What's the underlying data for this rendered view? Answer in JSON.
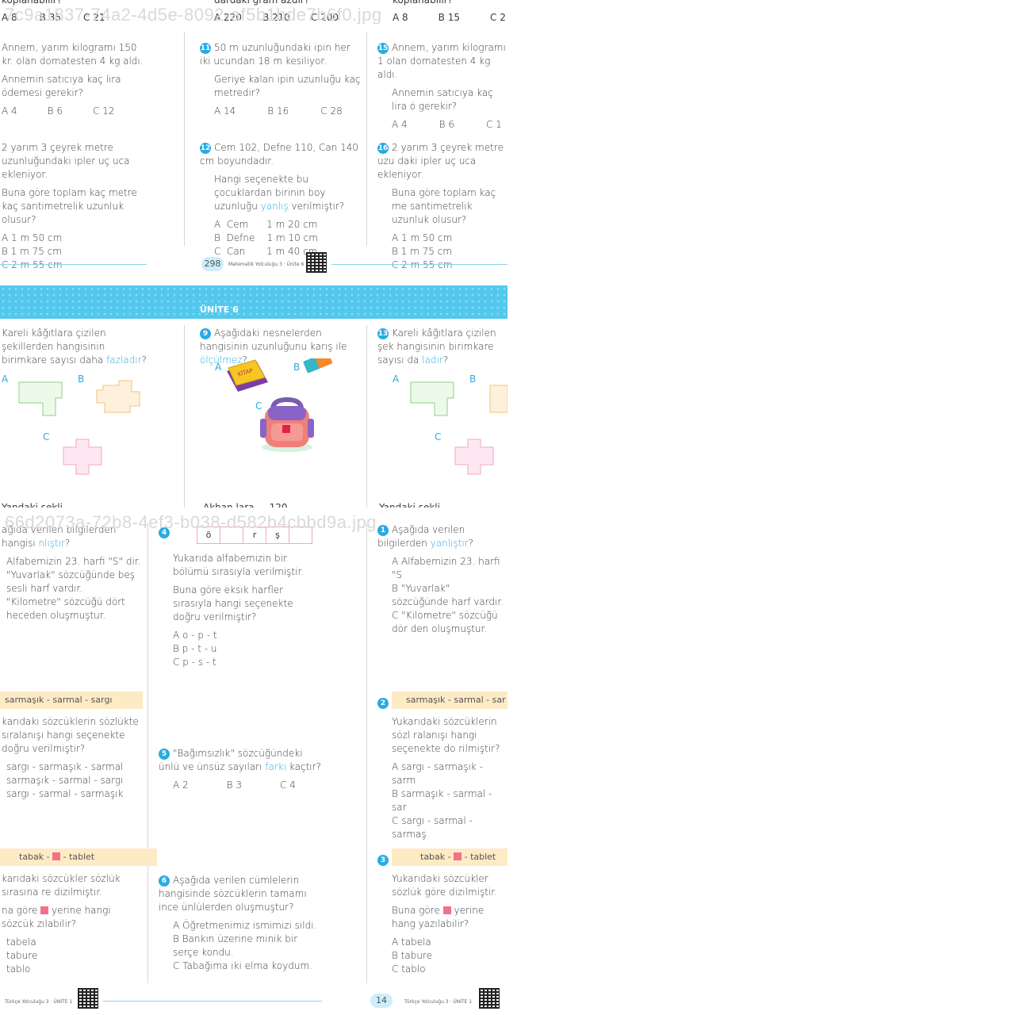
{
  "page_a": {
    "filename": "7c9a1837-74a2-4d5e-8092-af5b1bde7b6f0.jpg",
    "top_answers": {
      "left": [
        "A 8",
        "B 35",
        "C 21"
      ],
      "mid": [
        "A 220",
        "B 210",
        "C 200"
      ],
      "right": [
        "A 8",
        "B 15",
        "C 2"
      ]
    },
    "top_cut": {
      "left": "koplanabilir?",
      "mid": "dardaki gram azdır?",
      "right": "koplanabilir?"
    },
    "q_left_1": {
      "text": "Annem, yarım kilogramı 150 kr. olan domatesten 4 kg aldı.",
      "ask": "Annemin satıcıya kaç lira ödemesi gerekir?",
      "opts": [
        "A 4",
        "B 6",
        "C 12"
      ]
    },
    "q11": {
      "num": "11",
      "text": "50 m uzunluğundaki ipin her iki ucundan 18 m kesiliyor.",
      "ask": "Geriye kalan ipin uzunluğu kaç metredir?",
      "opts": [
        "A 14",
        "B 16",
        "C 28"
      ]
    },
    "q15": {
      "num": "15",
      "text": "Annem, yarım kilogramı 1 olan domatesten 4 kg aldı.",
      "ask": "Annemin satıcıya kaç lira ö gerekir?",
      "opts": [
        "A 4",
        "B 6",
        "C 1"
      ]
    },
    "q_left_2": {
      "text": "2 yarım 3 çeyrek metre uzunluğundaki ipler uç uca ekleniyor.",
      "ask": "Buna göre toplam kaç metre kaç santimetrelik uzunluk olusur?",
      "opts": [
        "A  1 m 50 cm",
        "B  1 m 75 cm",
        "C  2 m 55 cm"
      ]
    },
    "q12": {
      "num": "12",
      "text": "Cem 102, Defne 110, Can 140 cm boyundadır.",
      "ask_pre": "Hangi seçenekte bu çocuklardan birinin boy uzunluğu ",
      "ask_hl": "yanlış",
      "ask_post": " verilmiştir?",
      "opts": [
        "A  Cem      1 m 20 cm",
        "B  Defne    1 m 10 cm",
        "C  Can       1 m 40 cm"
      ]
    },
    "q16": {
      "num": "16",
      "text": "2 yarım 3 çeyrek metre uzu daki ipler uç uca ekleniyor.",
      "ask": "Buna göre toplam kaç me santimetrelik uzunluk olusur?",
      "opts": [
        "A  1 m 50 cm",
        "B  1 m 75 cm",
        "C  2 m 55 cm"
      ]
    },
    "page_number": "298",
    "footer": "Matematik Yolculuğu 3 · Ünite 6",
    "banner": "ÜNİTE 6",
    "q_left_3": {
      "pre": "Kareli kâğıtlara çizilen şekillerden hangisinin birimkare sayısı daha ",
      "hl": "fazladır",
      "post": "?",
      "labels": [
        "A",
        "B",
        "C"
      ]
    },
    "q9": {
      "num": "9",
      "pre": "Aşağıdaki nesnelerden hangisinin uzunluğunu karış ile ",
      "hl": "ölçülmez",
      "post": "?",
      "labels": [
        "A",
        "B",
        "C"
      ],
      "book_text": "KİTAP"
    },
    "q13": {
      "num": "13",
      "pre": "Kareli kâğıtlara çizilen şek hangisinin birimkare sayısı da ",
      "hl": "ladır",
      "post": "?",
      "labels": [
        "A",
        "B",
        "C"
      ]
    },
    "bottom_cut": {
      "left": "Yandaki şekli",
      "mid": "Akhan lara ... 120",
      "right": "Yandaki şekli"
    }
  },
  "page_b": {
    "filename": "66d2073a-72b8-4ef3-b038-d582b4cbbd9a.jpg",
    "q1_left": {
      "pre": "ağıda verilen bilgilerden hangisi ",
      "hl": "nlıştır",
      "post": "?",
      "opts": [
        "Alfabemizin 23. harfi \"S\" dir.",
        "\"Yuvarlak\" sözcüğünde beş sesli harf vardır.",
        "\"Kilometre\" sözcüğü dört heceden oluşmuştur."
      ]
    },
    "q4": {
      "num": "4",
      "letters": [
        "ö",
        "r",
        "ş"
      ],
      "text": "Yukarıda alfabemizin bir bölümü sırasıyla verilmiştir.",
      "ask": "Buna göre eksik harfler sırasıyla hangi seçenekte doğru verilmiştir?",
      "opts": [
        "A  o - p - t",
        "B  p - t - u",
        "C  p - s - t"
      ]
    },
    "q1_right": {
      "num": "1",
      "pre": "Aşağıda verilen bilgilerden ",
      "hl": "yanlıştır",
      "post": "?",
      "opts": [
        "A  Alfabemizin 23. harfi \"S",
        "B  \"Yuvarlak\" sözcüğünde harf vardır.",
        "C  \"Kilometre\" sözcüğü dör den oluşmuştur."
      ]
    },
    "q2_left": {
      "box": "sarmaşık - sarmal - sargı",
      "ask": "karıdaki sözcüklerin sözlükte sıralanışı hangi seçenekte doğru verilmiştir?",
      "opts": [
        "sargı - sarmaşık - sarmal",
        "sarmaşık - sarmal - sargı",
        "sargı - sarmal - sarmaşık"
      ]
    },
    "q5": {
      "num": "5",
      "pre": "\"Bağımsızlık\" sözcüğündeki ünlü ve ünsüz sayıları ",
      "hl": "farkı",
      "post": " kaçtır?",
      "opts": [
        "A 2",
        "B 3",
        "C 4"
      ]
    },
    "q2_right": {
      "num": "2",
      "box": "sarmaşık - sarmal - sar",
      "ask": "Yukarıdaki sözcüklerin sözl ralanışı hangi seçenekte do rilmiştir?",
      "opts": [
        "A  sargı - sarmaşık - sarm",
        "B  sarmaşık - sarmal - sar",
        "C  sargı - sarmal - sarmaş"
      ]
    },
    "q3_left": {
      "box_pre": "tabak - ",
      "box_post": " - tablet",
      "text": "karıdaki sözcükler sözlük sırasına re dizilmiştir.",
      "ask_pre": "na göre ",
      "ask_post": " yerine hangi sözcük zılabilir?",
      "opts": [
        "tabela",
        "tabure",
        "tablo"
      ]
    },
    "q6": {
      "num": "6",
      "text": "Aşağıda verilen cümlelerin hangisinde sözcüklerin tamamı ince ünlülerden oluşmuştur?",
      "opts": [
        "A  Öğretmenimiz ismimizi sildi.",
        "B  Bankın üzerine minik bir serçe kondu.",
        "C  Tabağıma iki elma koydum."
      ]
    },
    "q3_right": {
      "num": "3",
      "box_pre": "tabak - ",
      "box_post": " - tablet",
      "text": "Yukarıdaki sözcükler sözlük göre dizilmiştir.",
      "ask_pre": "Buna göre ",
      "ask_post": " yerine hang yazılabilir?",
      "opts": [
        "A  tabela",
        "B  tabure",
        "C  tablo"
      ]
    },
    "page_number": "14",
    "footer": "Türkçe Yolculuğu 3 · ÜNİTE 1"
  }
}
